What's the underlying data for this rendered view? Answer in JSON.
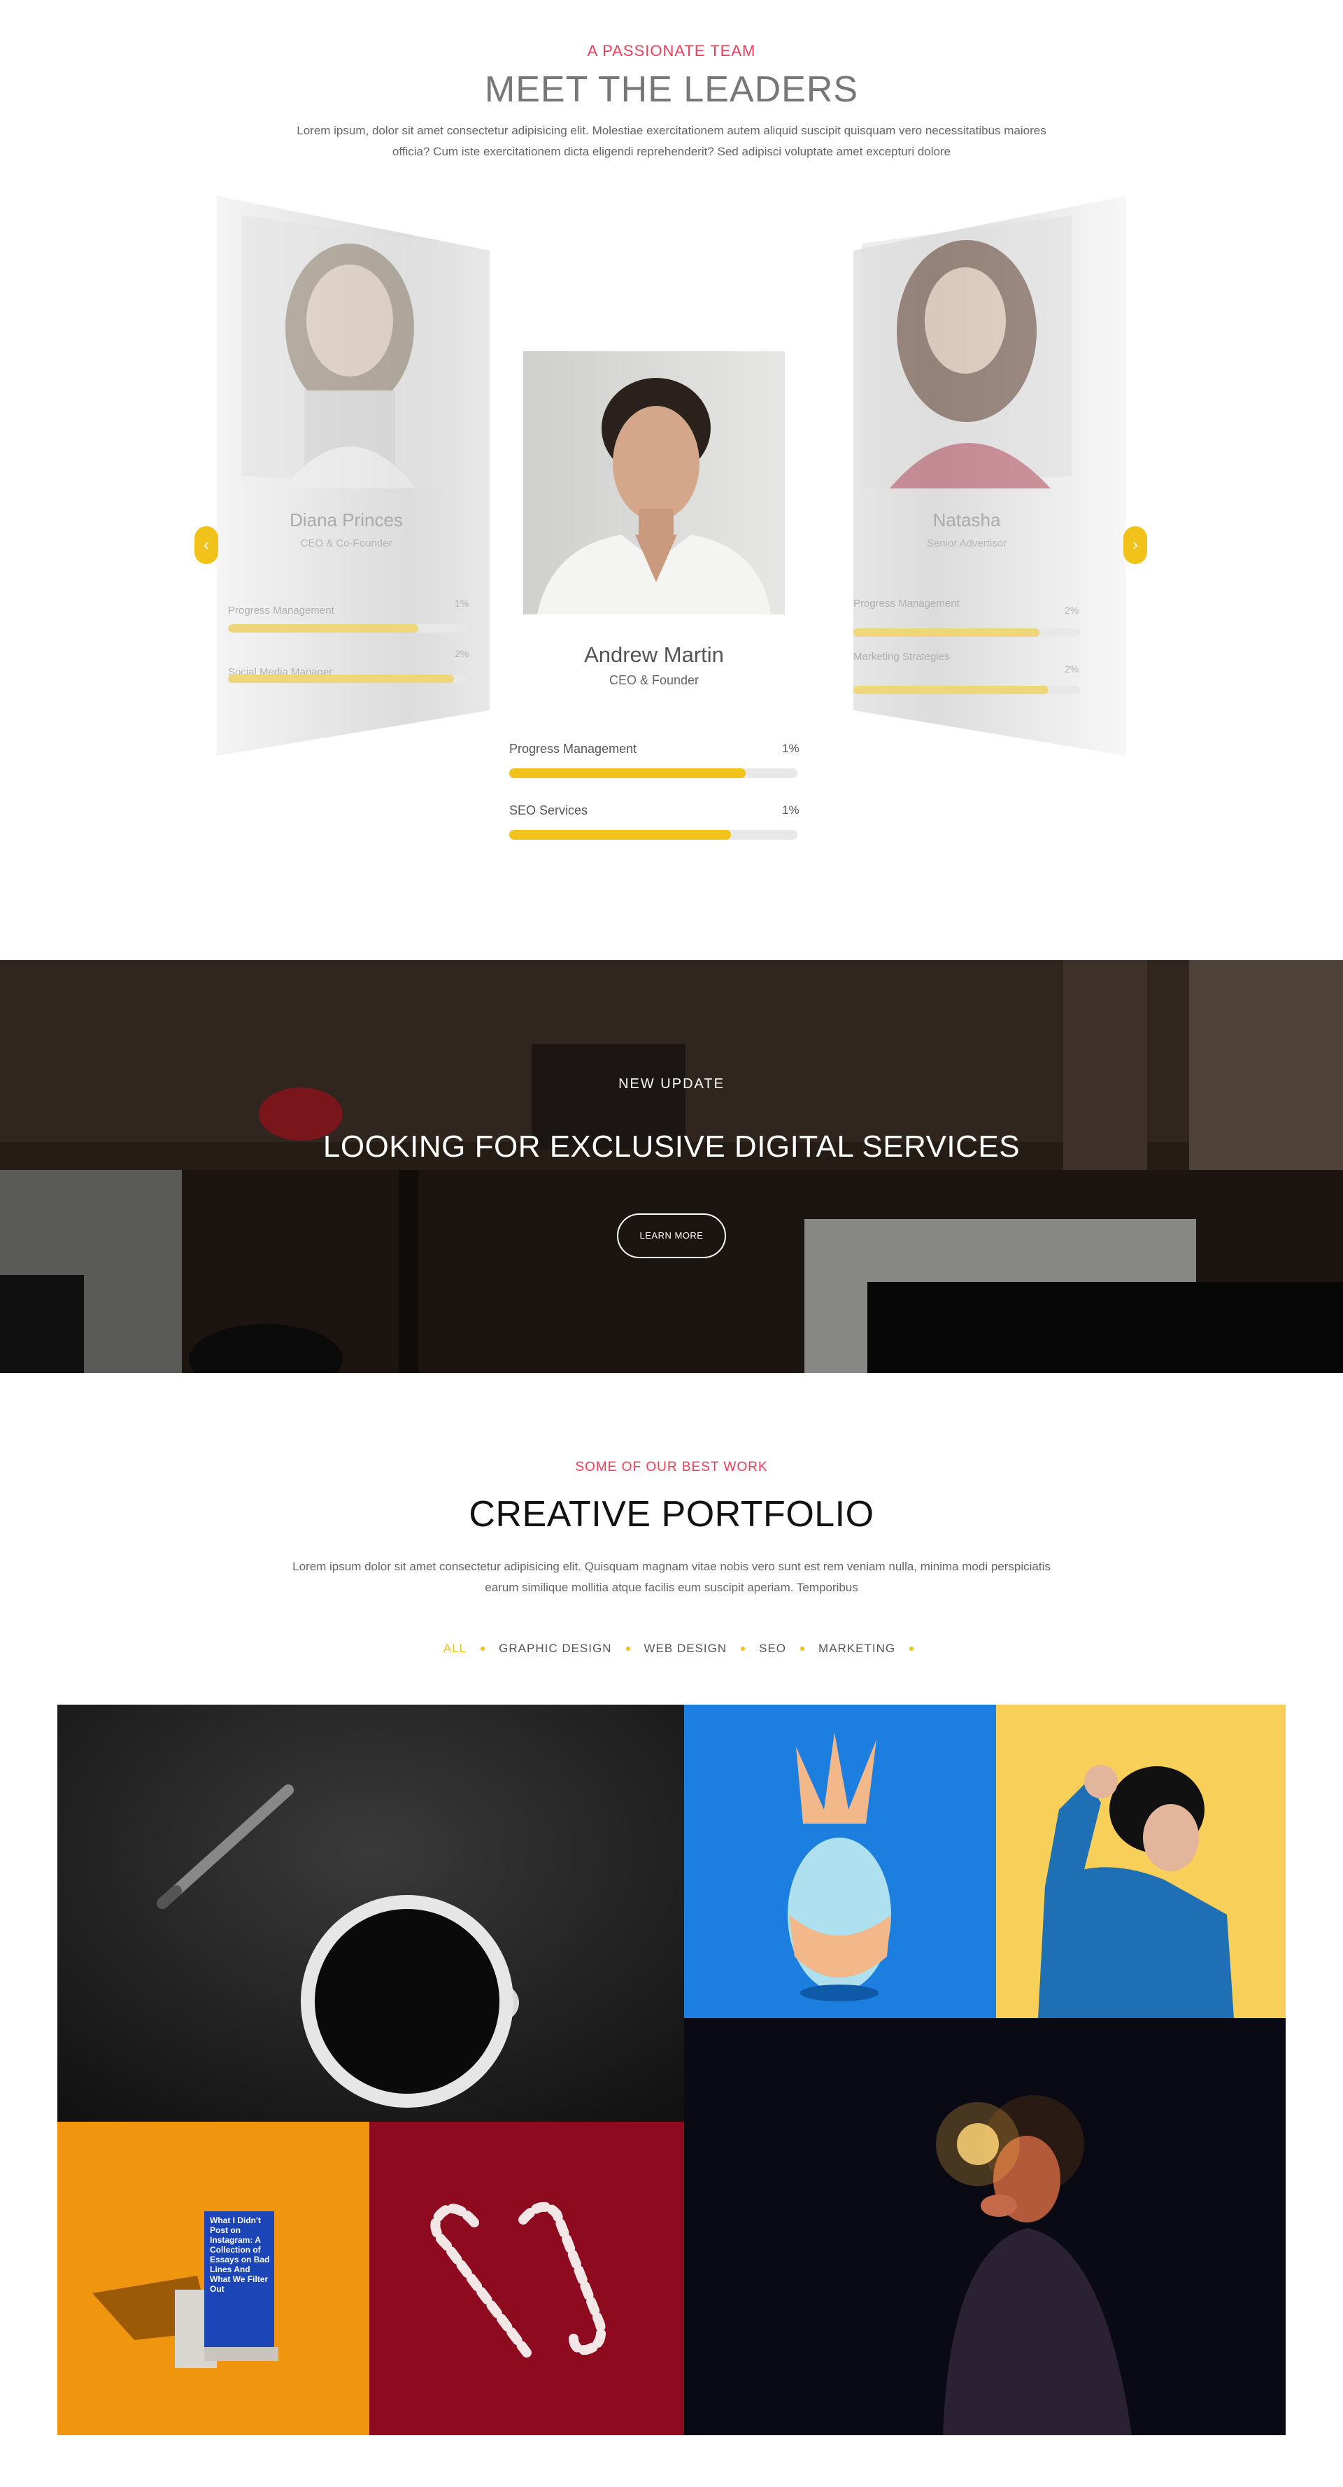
{
  "team": {
    "eyebrow": "A PASSIONATE TEAM",
    "title": "MEET THE LEADERS",
    "description_line1": "Lorem ipsum, dolor sit amet consectetur adipisicing elit. Molestiae exercitationem autem aliquid suscipit quisquam vero necessitatibus maiores",
    "description_line2": "officia? Cum iste exercitationem dicta eligendi reprehenderit? Sed adipisci voluptate amet excepturi dolore",
    "prev_icon": "chevron-left-icon",
    "next_icon": "chevron-right-icon",
    "members": [
      {
        "name": "Diana Princes",
        "role": "CEO & Co-Founder",
        "skills": [
          {
            "label": "Progress Management",
            "pct": "1%",
            "level": 0.8
          },
          {
            "label": "Social Media Manager",
            "pct": "2%",
            "level": 0.95
          }
        ]
      },
      {
        "name": "Andrew Martin",
        "role": "CEO & Founder",
        "skills": [
          {
            "label": "Progress Management",
            "pct": "1%",
            "level": 0.82
          },
          {
            "label": "SEO Services",
            "pct": "1%",
            "level": 0.77
          }
        ]
      },
      {
        "name": "Natasha",
        "role": "Senior Advertisor",
        "skills": [
          {
            "label": "Progress Management",
            "pct": "2%",
            "level": 0.82
          },
          {
            "label": "Marketing Strategies",
            "pct": "2%",
            "level": 0.86
          }
        ]
      }
    ]
  },
  "banner": {
    "eyebrow": "NEW UPDATE",
    "title": "LOOKING FOR EXCLUSIVE DIGITAL SERVICES",
    "button": "LEARN MORE"
  },
  "portfolio": {
    "eyebrow": "SOME OF OUR BEST WORK",
    "title": "CREATIVE PORTFOLIO",
    "description_line1": "Lorem ipsum dolor sit amet consectetur adipisicing elit. Quisquam magnam vitae nobis vero sunt est rem veniam nulla, minima modi perspiciatis",
    "description_line2": "earum similique mollitia atque facilis eum suscipit aperiam. Temporibus",
    "filters": [
      "ALL",
      "GRAPHIC DESIGN",
      "WEB DESIGN",
      "SEO",
      "MARKETING"
    ],
    "book_text": "What I Didn't Post on Instagram: A Collection of Essays on Bad Lines And What We Filter Out"
  },
  "colors": {
    "accent": "#f0c21a",
    "eyebrow": "#ee3f5a"
  }
}
